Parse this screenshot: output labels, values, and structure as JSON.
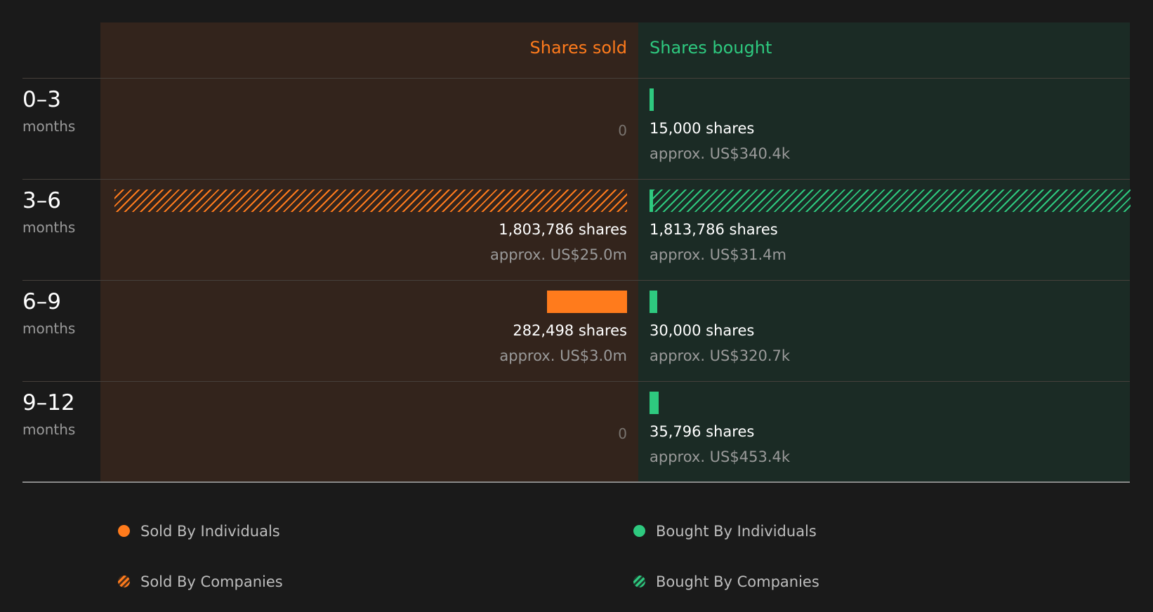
{
  "chart_data": {
    "type": "bar",
    "orientation": "horizontal-diverging",
    "headers": {
      "sold": "Shares sold",
      "bought": "Shares bought"
    },
    "period_unit": "months",
    "categories": [
      "0–3",
      "3–6",
      "6–9",
      "9–12"
    ],
    "series": [
      {
        "name": "Sold By Individuals",
        "side": "sold",
        "values": [
          0,
          0,
          282498,
          0
        ]
      },
      {
        "name": "Sold By Companies",
        "side": "sold",
        "values": [
          0,
          1803786,
          0,
          0
        ]
      },
      {
        "name": "Bought By Individuals",
        "side": "bought",
        "values": [
          15000,
          10000,
          30000,
          35796
        ]
      },
      {
        "name": "Bought By Companies",
        "side": "bought",
        "values": [
          0,
          1803786,
          0,
          0
        ]
      }
    ],
    "rows": [
      {
        "period": "0–3",
        "sold_shares": "0",
        "sold_value": "",
        "bought_shares": "15,000 shares",
        "bought_value": "approx. US$340.4k"
      },
      {
        "period": "3–6",
        "sold_shares": "1,803,786 shares",
        "sold_value": "approx. US$25.0m",
        "bought_shares": "1,813,786 shares",
        "bought_value": "approx. US$31.4m"
      },
      {
        "period": "6–9",
        "sold_shares": "282,498 shares",
        "sold_value": "approx. US$3.0m",
        "bought_shares": "30,000 shares",
        "bought_value": "approx. US$320.7k"
      },
      {
        "period": "9–12",
        "sold_shares": "0",
        "sold_value": "",
        "bought_shares": "35,796 shares",
        "bought_value": "approx. US$453.4k"
      }
    ],
    "legend": [
      {
        "label": "Sold By Individuals",
        "style": "solid",
        "color": "#ff7b1c"
      },
      {
        "label": "Bought By Individuals",
        "style": "solid",
        "color": "#2ec97f"
      },
      {
        "label": "Sold By Companies",
        "style": "hatched",
        "color": "#ff7b1c"
      },
      {
        "label": "Bought By Companies",
        "style": "hatched",
        "color": "#2ec97f"
      }
    ],
    "colors": {
      "sold": "#ff7b1c",
      "bought": "#2ec97f"
    },
    "legend_placement": "bottom"
  }
}
